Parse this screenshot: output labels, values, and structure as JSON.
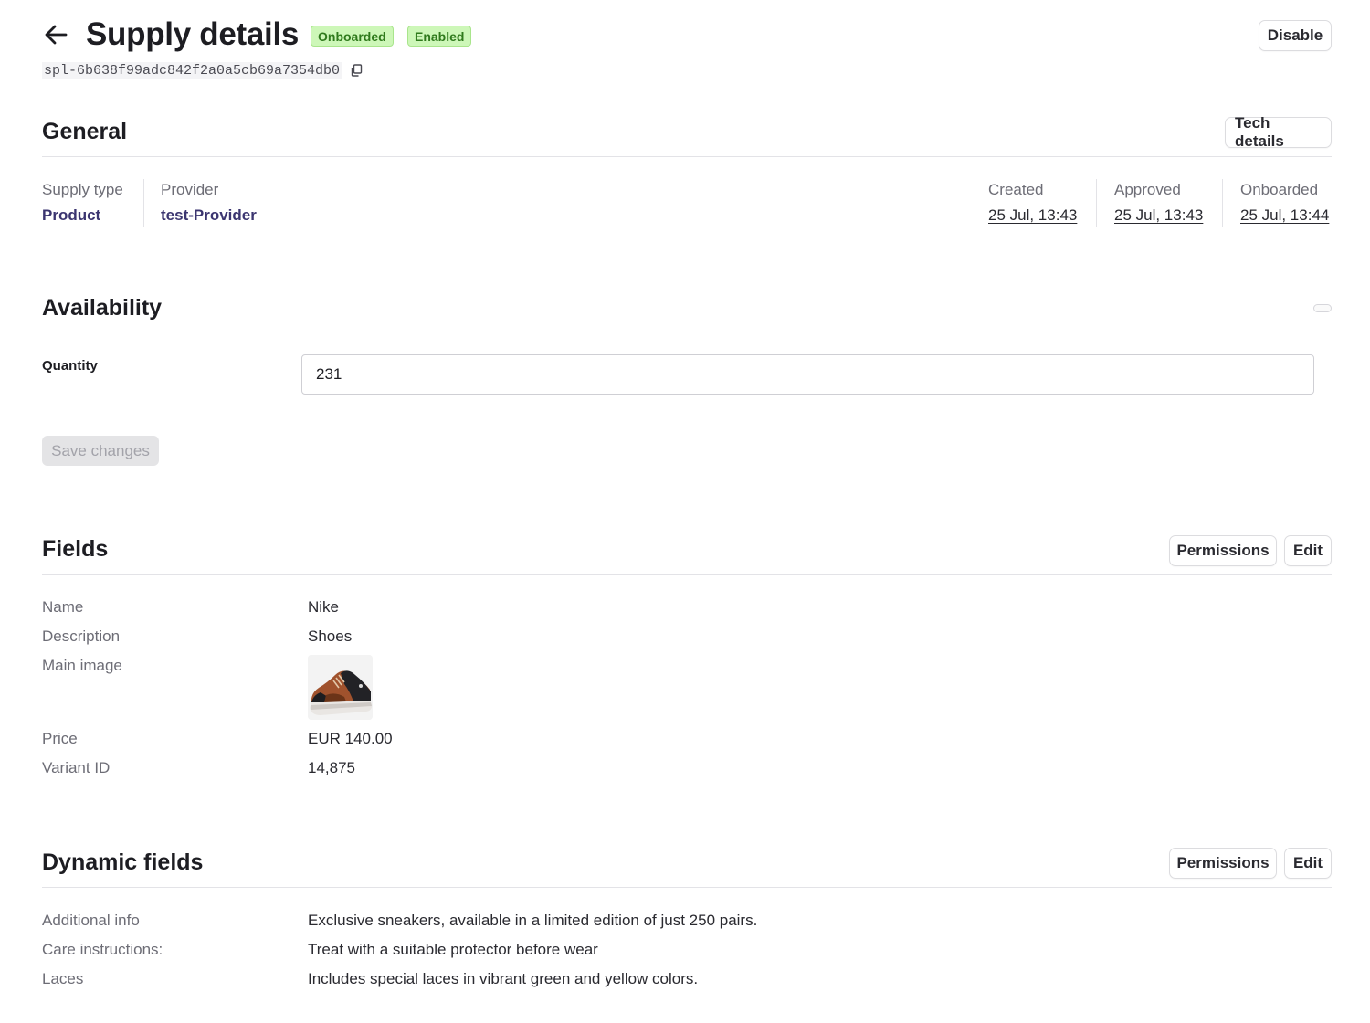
{
  "header": {
    "title": "Supply details",
    "badges": [
      "Onboarded",
      "Enabled"
    ],
    "supply_id": "spl-6b638f99adc842f2a0a5cb69a7354db0",
    "disable_label": "Disable",
    "icons": {
      "back": "arrow-left-icon",
      "copy": "copy-icon"
    }
  },
  "general": {
    "title": "General",
    "tech_details_label": "Tech details",
    "supply_type": {
      "label": "Supply type",
      "value": "Product"
    },
    "provider": {
      "label": "Provider",
      "value": "test-Provider"
    },
    "created": {
      "label": "Created",
      "value": "25 Jul, 13:43"
    },
    "approved": {
      "label": "Approved",
      "value": "25 Jul, 13:43"
    },
    "onboarded": {
      "label": "Onboarded",
      "value": "25 Jul, 13:44"
    }
  },
  "availability": {
    "title": "Availability",
    "quantity_label": "Quantity",
    "quantity_value": "231",
    "save_label": "Save changes"
  },
  "fields": {
    "title": "Fields",
    "permissions_label": "Permissions",
    "edit_label": "Edit",
    "name": {
      "label": "Name",
      "value": "Nike"
    },
    "description": {
      "label": "Description",
      "value": "Shoes"
    },
    "main_image": {
      "label": "Main image",
      "value": "sneaker-image"
    },
    "price": {
      "label": "Price",
      "value": "EUR 140.00"
    },
    "variant_id": {
      "label": "Variant ID",
      "value": "14,875"
    }
  },
  "dynamic_fields": {
    "title": "Dynamic fields",
    "permissions_label": "Permissions",
    "edit_label": "Edit",
    "additional_info": {
      "label": "Additional info",
      "value": "Exclusive sneakers, available in a limited edition of just 250 pairs."
    },
    "care_instructions": {
      "label": "Care instructions:",
      "value": "Treat with a suitable protector before wear"
    },
    "laces": {
      "label": "Laces",
      "value": "Includes special laces in vibrant green and yellow colors."
    }
  },
  "colors": {
    "badge_bg": "#cdf7b8",
    "badge_text": "#2f7a1c",
    "strong_value": "#3b3570",
    "divider": "#e3e3e7",
    "muted_label": "#6d6d76"
  }
}
